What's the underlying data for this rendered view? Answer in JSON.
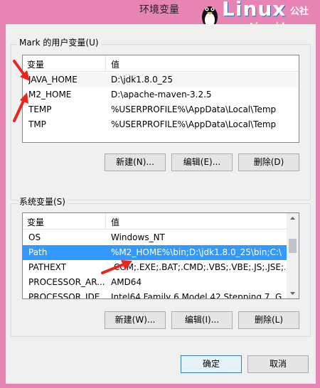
{
  "window": {
    "title": "环境变量"
  },
  "watermark": {
    "brand": "Linux",
    "brand_cn": "公社",
    "url": "www.Linuxidc.com"
  },
  "user_vars": {
    "group_label": "Mark 的用户变量(U)",
    "col_var": "变量",
    "col_val": "值",
    "rows": [
      {
        "name": "JAVA_HOME",
        "value": "D:\\jdk1.8.0_25"
      },
      {
        "name": "M2_HOME",
        "value": "D:\\apache-maven-3.2.5"
      },
      {
        "name": "TEMP",
        "value": "%USERPROFILE%\\AppData\\Local\\Temp"
      },
      {
        "name": "TMP",
        "value": "%USERPROFILE%\\AppData\\Local\\Temp"
      }
    ],
    "btn_new": "新建(N)...",
    "btn_edit": "编辑(E)...",
    "btn_delete": "删除(D)"
  },
  "system_vars": {
    "group_label": "系统变量(S)",
    "col_var": "变量",
    "col_val": "值",
    "rows": [
      {
        "name": "OS",
        "value": "Windows_NT"
      },
      {
        "name": "Path",
        "value": "%M2_HOME%\\bin;D:\\jdk1.8.0_25\\bin;C:\\..."
      },
      {
        "name": "PATHEXT",
        "value": ".COM;.EXE;.BAT;.CMD;.VBS;.VBE;.JS;.JSE;..."
      },
      {
        "name": "PROCESSOR_AR...",
        "value": "AMD64"
      },
      {
        "name": "PROCESSOR_IDE...",
        "value": "Intel64 Family 6 Model 42 Stepping 7, G..."
      }
    ],
    "btn_new": "新建(W)...",
    "btn_edit": "编辑(I)...",
    "btn_delete": "删除(L)"
  },
  "footer": {
    "ok": "确定",
    "cancel": "取消"
  },
  "colors": {
    "selection": "#3399ff",
    "annotation_arrow": "#e8261c",
    "titlebar": "#e884b4"
  }
}
